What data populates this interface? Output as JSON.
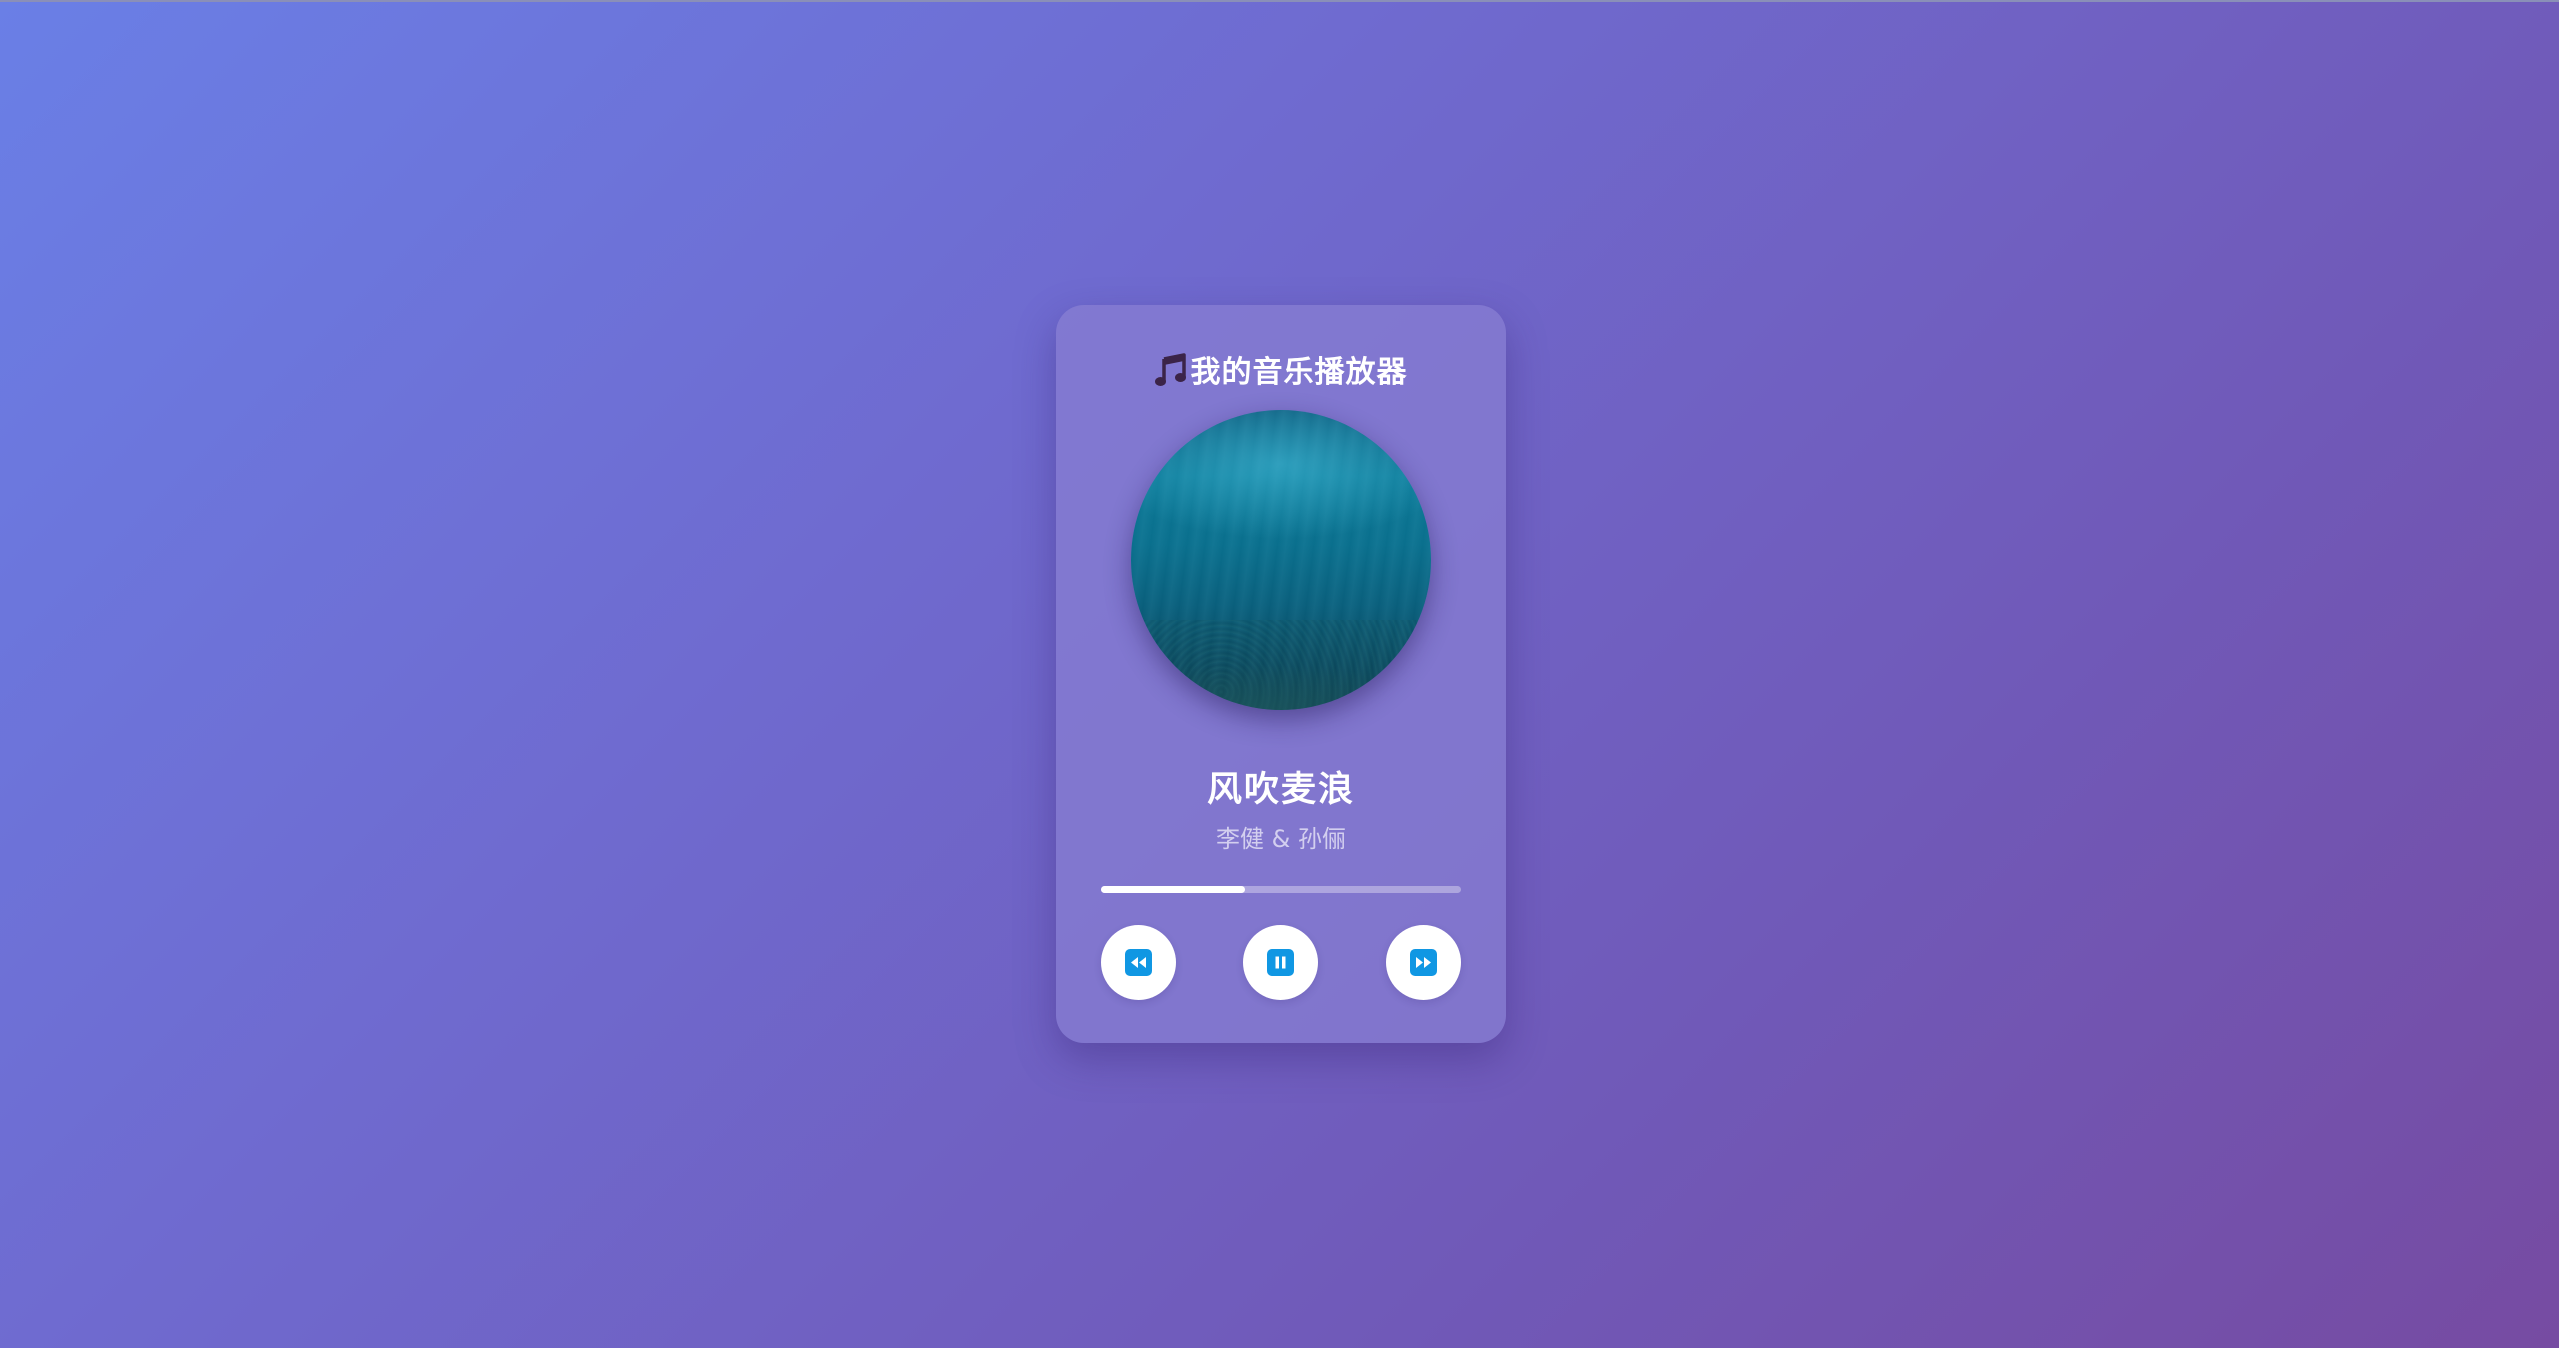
{
  "player": {
    "app_title": "我的音乐播放器",
    "title_icon": "music-note-icon",
    "song_title": "风吹麦浪",
    "artist": "李健 & 孙俪",
    "progress_fraction": 0.4,
    "album_art": "underwater-ocean-scene",
    "controls": {
      "prev_icon": "rewind-icon",
      "play_pause_icon": "pause-icon",
      "next_icon": "fast-forward-icon"
    }
  },
  "colors": {
    "background_start": "#667eea",
    "background_end": "#764ba2",
    "button_icon": "#1097e3",
    "title_icon": "#3b2448"
  }
}
